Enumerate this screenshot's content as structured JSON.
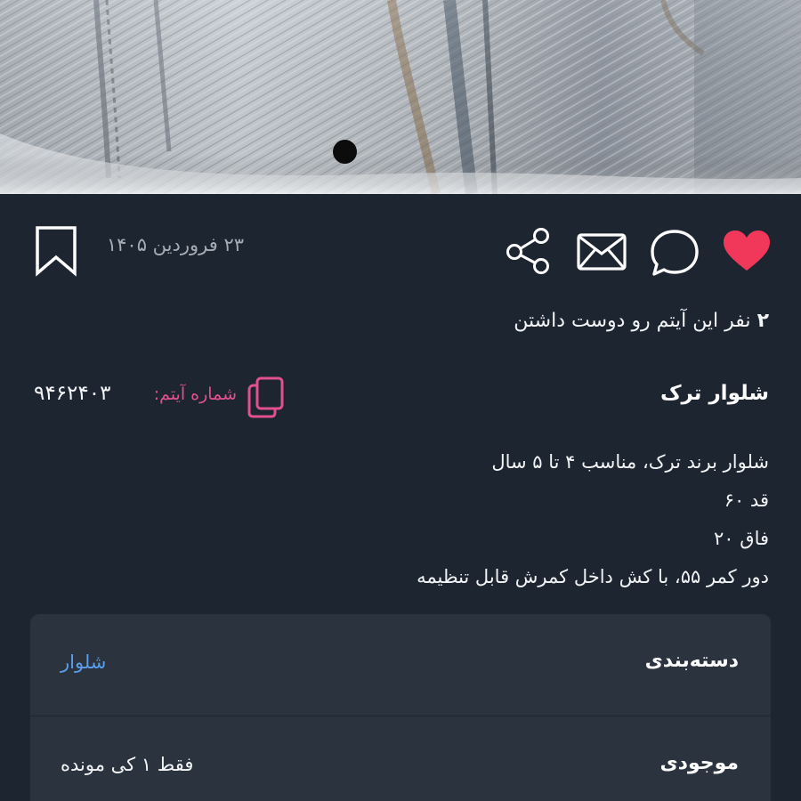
{
  "header_image": {
    "description_icon": "denim-photo"
  },
  "actions": {
    "bookmark_icon": "bookmark-icon",
    "share_icon": "share-icon",
    "mail_icon": "mail-icon",
    "comment_icon": "comment-icon",
    "like_icon": "heart-icon",
    "like_color": "#f2385a"
  },
  "post": {
    "date": "۲۳ فروردین ۱۴۰۵",
    "likes_count": "۲",
    "likes_text": "نفر این آیتم رو دوست داشتن",
    "title": "شلوار ترک",
    "item_number_label": "شماره آیتم:",
    "item_number": "۹۴۶۲۴۰۳",
    "copy_icon": "copy-icon",
    "accent_color": "#e2508f",
    "description_lines": [
      "شلوار برند ترک، مناسب ۴ تا ۵ سال",
      "قد ۶۰",
      "فاق ۲۰",
      "دور کمر ۵۵، با کش داخل کمرش قابل تنظیمه"
    ]
  },
  "details": {
    "category_label": "دسته‌بندی",
    "category_value": "شلوار",
    "stock_label": "موجودی",
    "stock_value": "فقط ۱ کی مونده"
  }
}
